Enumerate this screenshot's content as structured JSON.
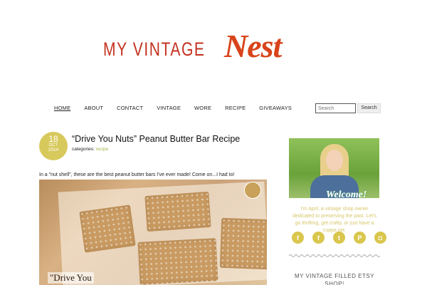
{
  "logo": {
    "plain": "MY VINTAGE",
    "script": "Nest"
  },
  "nav": {
    "items": [
      {
        "label": "HOME",
        "active": true
      },
      {
        "label": "ABOUT",
        "active": false
      },
      {
        "label": "CONTACT",
        "active": false
      },
      {
        "label": "VINTAGE",
        "active": false
      },
      {
        "label": "WORE",
        "active": false
      },
      {
        "label": "RECIPE",
        "active": false
      },
      {
        "label": "GIVEAWAYS",
        "active": false
      }
    ]
  },
  "search": {
    "placeholder": "Search",
    "button_label": "Search"
  },
  "post": {
    "date": {
      "day": "18",
      "month": "OCT",
      "year": "2014"
    },
    "title": "“Drive You Nuts” Peanut Butter Bar Recipe",
    "categories_label": "categories:",
    "category": "recipe",
    "excerpt": "In a \"nut shell\", these are the best peanut butter bars I've ever made! Come on...I had to!",
    "image_caption": "\"Drive You"
  },
  "sidebar": {
    "welcome": "Welcome!",
    "about_text": "I'm April, a vintage shop owner dedicated to preserving the past. Let's go thrifting, get crafty, or just have a cuppa joe.",
    "socials": [
      {
        "name": "facebook-icon",
        "glyph": "f"
      },
      {
        "name": "facebook-alt-icon",
        "glyph": "f"
      },
      {
        "name": "twitter-icon",
        "glyph": "t"
      },
      {
        "name": "pinterest-icon",
        "glyph": "P"
      },
      {
        "name": "instagram-icon",
        "glyph": "◘"
      }
    ],
    "etsy_heading": "MY VINTAGE FILLED ETSY SHOP!"
  },
  "colors": {
    "accent": "#d8c95d",
    "logo_red": "#c4311f",
    "category": "#a8b44a"
  }
}
